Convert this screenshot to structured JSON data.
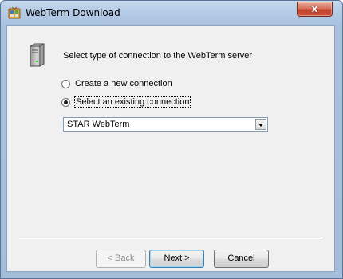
{
  "window": {
    "title": "WebTerm Download",
    "close_label": "x"
  },
  "header": {
    "text": "Select type of connection to the WebTerm server",
    "icon": "server-icon"
  },
  "options": [
    {
      "label": "Create a new connection",
      "checked": false
    },
    {
      "label": "Select an existing connection",
      "checked": true
    }
  ],
  "connection_select": {
    "value": "STAR WebTerm"
  },
  "buttons": {
    "back": "< Back",
    "next": "Next >",
    "cancel": "Cancel"
  }
}
